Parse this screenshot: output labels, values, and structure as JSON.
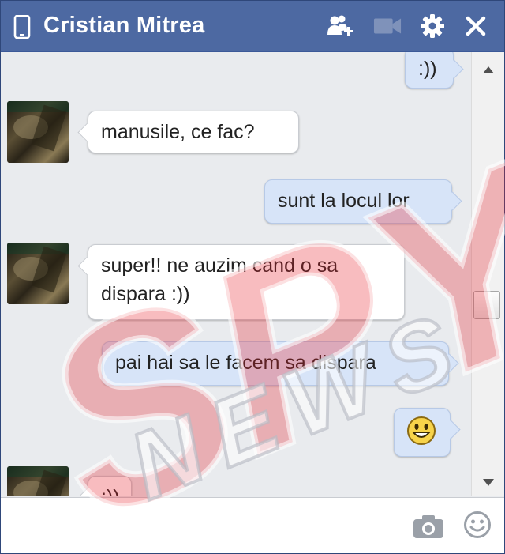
{
  "window": {
    "title": "Cristian Mitrea",
    "icons": [
      "phone-icon",
      "add-friend-icon",
      "video-call-icon",
      "gear-icon",
      "close-icon"
    ]
  },
  "messages": {
    "m1": {
      "text": ":))",
      "direction": "outgoing"
    },
    "m2": {
      "text": "manusile, ce fac?",
      "direction": "incoming"
    },
    "m3": {
      "text": "sunt la locul lor",
      "direction": "outgoing"
    },
    "m4": {
      "line1": "super!! ne auzim cand o sa",
      "line2": "dispara :))",
      "direction": "incoming"
    },
    "m5": {
      "text": "pai hai sa le facem sa dispara",
      "direction": "outgoing"
    },
    "m6": {
      "emoji": "smiley",
      "direction": "outgoing"
    },
    "m7": {
      "text": ":))",
      "direction": "incoming"
    }
  },
  "composer": {
    "value": "",
    "icons": [
      "camera-icon",
      "emoji-icon"
    ]
  },
  "watermark": {
    "line1": "SPY",
    "line2": "NEWS"
  },
  "colors": {
    "titlebar": "#4d69a2",
    "outgoing_bubble": "#d7e4f8",
    "incoming_bubble": "#ffffff",
    "watermark_red": "#e8202a"
  }
}
